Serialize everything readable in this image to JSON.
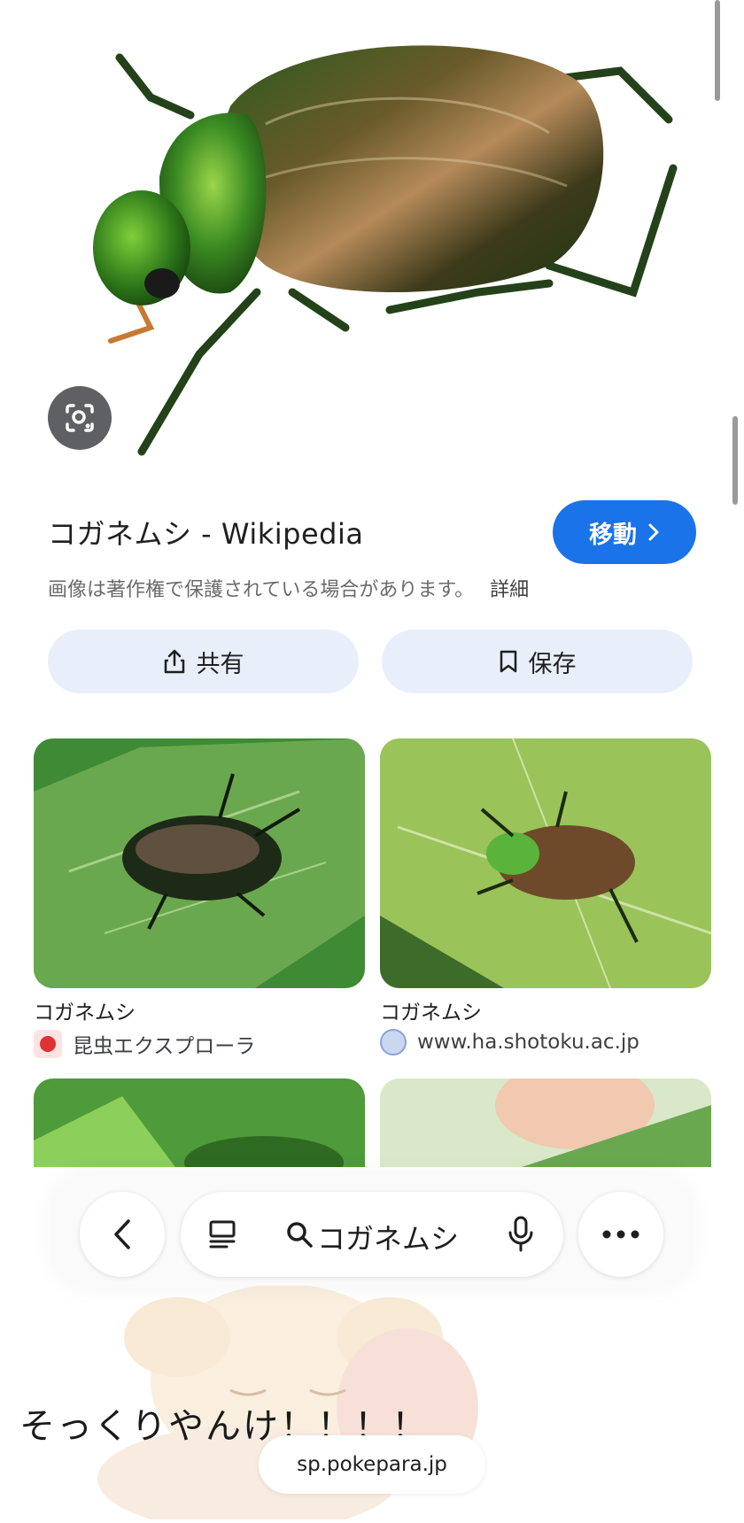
{
  "result": {
    "title": "コガネムシ - Wikipedia",
    "visit_label": "移動",
    "copyright_note": "画像は著作権で保護されている場合があります。",
    "details_label": "詳細",
    "share_label": "共有",
    "save_label": "保存"
  },
  "related": [
    {
      "title": "コガネムシ",
      "source": "昆虫エクスプローラ",
      "source_icon": "ladybug-icon"
    },
    {
      "title": "コガネムシ",
      "source": "www.ha.shotoku.ac.jp",
      "source_icon": "globe-icon"
    }
  ],
  "bottom_bar": {
    "query": "コガネムシ"
  },
  "overlay": {
    "caption": "そっくりやんけ！！！！",
    "url": "sp.pokepara.jp"
  },
  "colors": {
    "accent": "#1a73e8",
    "pill_bg": "#e8effb",
    "lens_bg": "#5f6063"
  }
}
